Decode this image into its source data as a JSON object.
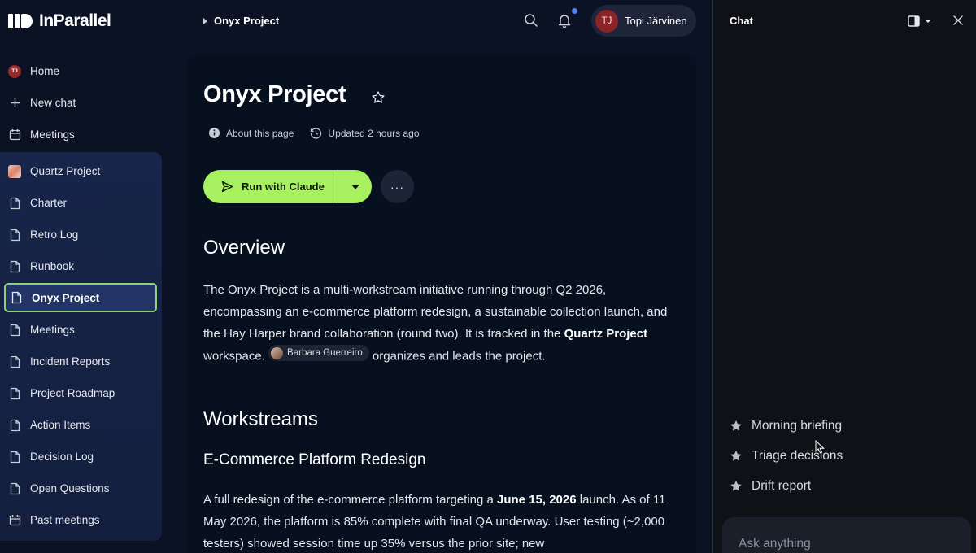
{
  "app": {
    "logo_text": "InParallel"
  },
  "sidebar": {
    "top_items": [
      {
        "label": "Home",
        "icon": "avatar-icon",
        "avatar_initials": "TJ"
      },
      {
        "label": "New chat",
        "icon": "plus-icon"
      },
      {
        "label": "Meetings",
        "icon": "calendar-icon"
      }
    ],
    "workspace_items": [
      {
        "label": "Quartz Project",
        "icon": "workspace-thumbnail"
      },
      {
        "label": "Charter",
        "icon": "document-icon"
      },
      {
        "label": "Retro Log",
        "icon": "document-icon"
      },
      {
        "label": "Runbook",
        "icon": "document-icon"
      },
      {
        "label": "Onyx Project",
        "icon": "document-icon",
        "active": true
      },
      {
        "label": "Meetings",
        "icon": "document-icon"
      },
      {
        "label": "Incident Reports",
        "icon": "document-icon"
      },
      {
        "label": "Project Roadmap",
        "icon": "document-icon"
      },
      {
        "label": "Action Items",
        "icon": "document-icon"
      },
      {
        "label": "Decision Log",
        "icon": "document-icon"
      },
      {
        "label": "Open Questions",
        "icon": "document-icon"
      },
      {
        "label": "Past meetings",
        "icon": "calendar-icon"
      }
    ]
  },
  "header": {
    "breadcrumb": "Onyx Project",
    "user": {
      "initials": "TJ",
      "name": "Topi Järvinen"
    },
    "notification_dot_color": "#4f7df5"
  },
  "page": {
    "title": "Onyx Project",
    "about_label": "About this page",
    "updated_label": "Updated 2 hours ago",
    "run_button_label": "Run with Claude",
    "run_button_color": "#a7f060",
    "more_label": "···",
    "overview_heading": "Overview",
    "overview": {
      "t1": "The Onyx Project is a multi-workstream initiative running through Q2 2026, encompassing an e-commerce platform redesign, a sustainable collection launch, and the Hay Harper brand collaboration (round two). It is tracked in the ",
      "workspace": "Quartz Project",
      "t2": " workspace. ",
      "mention": "Barbara Guerreiro",
      "t3": " organizes and leads the project."
    },
    "workstreams_heading": "Workstreams",
    "ecommerce_heading": "E-Commerce Platform Redesign",
    "ecommerce": {
      "t1": "A full redesign of the e-commerce platform targeting a ",
      "date": "June 15, 2026",
      "t2": " launch. As of 11 May 2026, the platform is 85% complete with final QA underway. User testing (~2,000 testers) showed session time up 35% versus the prior site; new"
    }
  },
  "chat": {
    "title": "Chat",
    "suggestions": [
      "Morning briefing",
      "Triage decisions",
      "Drift report"
    ],
    "input_placeholder": "Ask anything"
  }
}
